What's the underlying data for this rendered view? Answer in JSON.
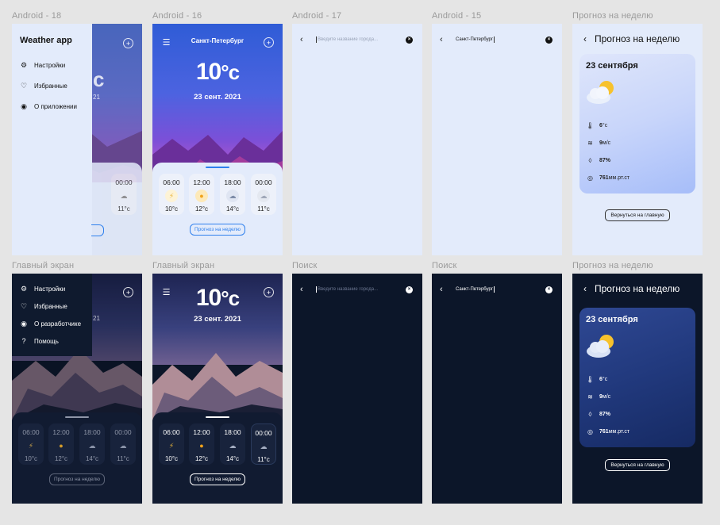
{
  "frames": {
    "labels_top": [
      "Android - 18",
      "Android - 16",
      "Android - 17",
      "Android - 15",
      "Прогноз на неделю"
    ],
    "labels_bottom": [
      "Главный экран",
      "Главный экран",
      "Поиск",
      "Поиск",
      "Прогноз на неделю"
    ]
  },
  "app": {
    "title": "Weather app",
    "city": "Санкт-Петербург",
    "temperature": "10",
    "unit": "°c",
    "date": "23 сент. 2021",
    "week_button": "Прогноз на неделю",
    "menu_light": [
      "Настройки",
      "Избранные",
      "О приложении"
    ],
    "menu_dark": [
      "Настройки",
      "Избранные",
      "О разработчике",
      "Помощь"
    ],
    "hours": [
      {
        "time": "06:00",
        "icon": "lightning-icon",
        "temp": "10",
        "unit": "°c"
      },
      {
        "time": "12:00",
        "icon": "sun-icon",
        "temp": "12",
        "unit": "°c"
      },
      {
        "time": "18:00",
        "icon": "rain-cloud-icon",
        "temp": "14",
        "unit": "°c"
      },
      {
        "time": "00:00",
        "icon": "snow-cloud-icon",
        "temp": "11",
        "unit": "°c"
      }
    ],
    "partial_hours": {
      "t1": "06:00",
      "t2": "12:00",
      "temp": "12",
      "unit": "°c",
      "peek": "11°c"
    },
    "peek_temp_partial": "c",
    "peek_light": "21",
    "peek_dark": "21"
  },
  "search": {
    "placeholder": "Введите название города...",
    "query": "Санкт-Петербург"
  },
  "week": {
    "title": "Прогноз на неделю",
    "date": "23 сентября",
    "temp": "6",
    "temp_unit": "°c",
    "wind": "9",
    "wind_unit": "м/с",
    "humidity": "87%",
    "pressure": "761",
    "pressure_unit": "мм.рт.ст",
    "back_button": "Вернуться на главную"
  },
  "colors": {
    "accent": "#2f80ed",
    "light_bg": "#e3ebfb",
    "dark_bg": "#0c1629"
  }
}
